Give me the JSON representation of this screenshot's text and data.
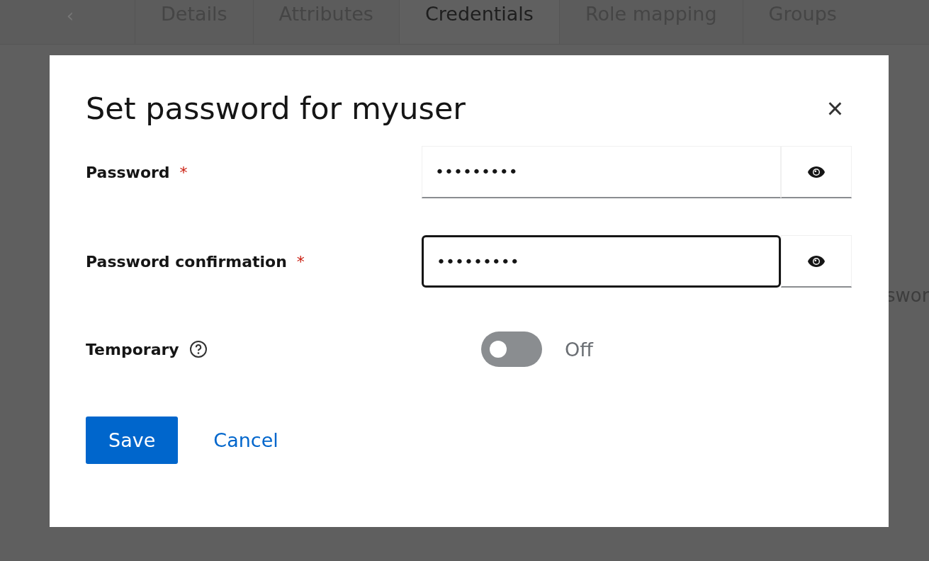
{
  "background": {
    "tab_scroll_left": "‹",
    "tabs": [
      {
        "label": "Details",
        "selected": false
      },
      {
        "label": "Attributes",
        "selected": false
      },
      {
        "label": "Credentials",
        "selected": true
      },
      {
        "label": "Role mapping",
        "selected": false
      },
      {
        "label": "Groups",
        "selected": false
      }
    ],
    "partial_text": "swor"
  },
  "dialog": {
    "title": "Set password for myuser",
    "close": "×",
    "fields": [
      {
        "label": "Password",
        "required_mark": "*",
        "value": "•••••••••",
        "focused": false
      },
      {
        "label": "Password confirmation",
        "required_mark": "*",
        "value": "•••••••••",
        "focused": true
      }
    ],
    "temporary": {
      "label": "Temporary",
      "on": false,
      "state_label": "Off"
    },
    "buttons": [
      {
        "label": "Save",
        "kind": "primary"
      },
      {
        "label": "Cancel",
        "kind": "link"
      }
    ]
  }
}
